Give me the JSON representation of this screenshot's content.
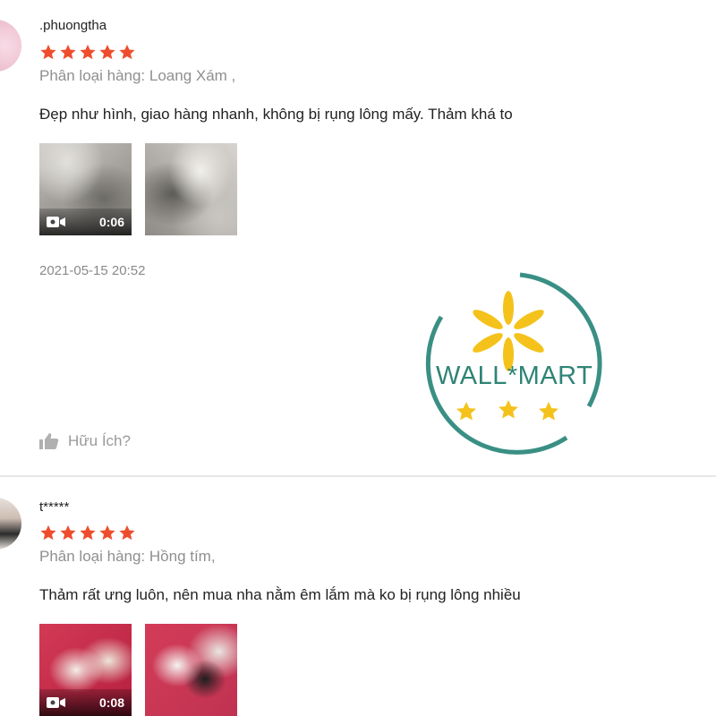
{
  "reviews": [
    {
      "username": ".phuongtha",
      "rating": 5,
      "variant": "Phân loại hàng: Loang Xám ,",
      "comment": "Đẹp như hình, giao hàng nhanh, không bị rụng lông mấy. Thảm khá to",
      "media": [
        {
          "type": "video",
          "duration": "0:06"
        },
        {
          "type": "image"
        }
      ],
      "timestamp": "2021-05-15 20:52",
      "helpful_label": "Hữu Ích?"
    },
    {
      "username": "t*****",
      "rating": 5,
      "variant": "Phân loại hàng: Hồng tím,",
      "comment": "Thảm rất ưng luôn, nên mua nha nằm êm lắm mà ko bị rụng lông nhiều",
      "media": [
        {
          "type": "video",
          "duration": "0:08"
        },
        {
          "type": "image"
        }
      ]
    }
  ],
  "watermark": {
    "brand": "WALL*MART",
    "ring_color": "#3a8f84",
    "spark_color": "#f4c21b",
    "star_color": "#f4c21b",
    "text_color": "#2f8475"
  },
  "colors": {
    "star": "#ee4d2d",
    "muted_text": "#8f8f8f"
  }
}
